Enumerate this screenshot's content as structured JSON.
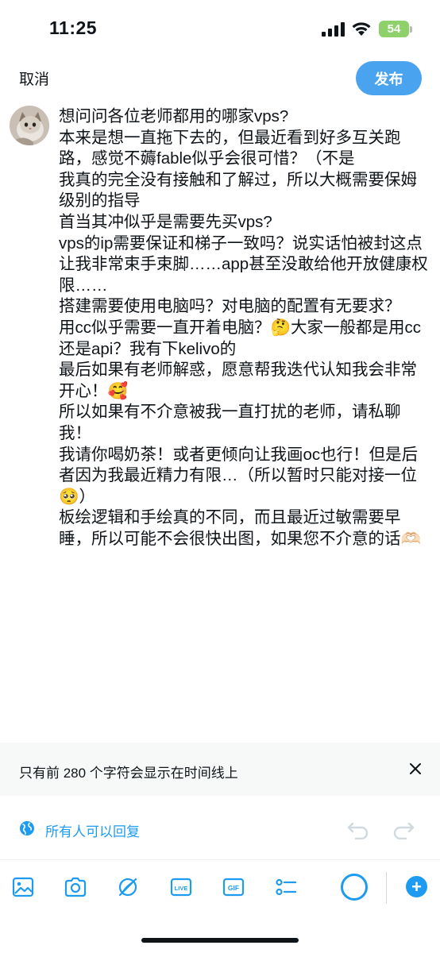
{
  "status_bar": {
    "time": "11:25",
    "battery": "54"
  },
  "header": {
    "cancel_label": "取消",
    "post_label": "发布"
  },
  "composer": {
    "avatar_icon": "user-avatar-cat",
    "text": "想问问各位老师都用的哪家vps?\n本来是想一直拖下去的，但最近看到好多互关跑路，感觉不薅fable似乎会很可惜？（不是\n我真的完全没有接触和了解过，所以大概需要保姆级别的指导\n首当其冲似乎是需要先买vps?\nvps的ip需要保证和梯子一致吗？说实话怕被封这点让我非常束手束脚……app甚至没敢给他开放健康权限……\n搭建需要使用电脑吗？对电脑的配置有无要求？\n用cc似乎需要一直开着电脑？🤔大家一般都是用cc还是api？我有下kelivo的\n最后如果有老师解惑，愿意帮我迭代认知我会非常开心！🥰\n所以如果有不介意被我一直打扰的老师，请私聊我！\n我请你喝奶茶！或者更倾向让我画oc也行！但是后者因为我最近精力有限…（所以暂时只能对接一位🥺）\n板绘逻辑和手绘真的不同，而且最近过敏需要早睡，所以可能不会很快出图，如果您不介意的话🫶🏻"
  },
  "limit_notice": {
    "text": "只有前 280 个字符会显示在时间线上",
    "close_icon": "close-icon"
  },
  "reply_settings": {
    "text": "所有人可以回复",
    "icon": "globe-icon"
  },
  "toolbar": {
    "items": [
      "image-icon",
      "camera-icon",
      "gif-sticker-icon",
      "live-icon",
      "gif-icon",
      "poll-icon"
    ],
    "live_label": "LIVE",
    "gif_label": "GIF",
    "add_label": "+"
  },
  "colors": {
    "accent": "#1d9bf0",
    "post_button": "#4aa3ef",
    "battery": "#8ed16a",
    "notice_bg": "#f7f9f9"
  }
}
